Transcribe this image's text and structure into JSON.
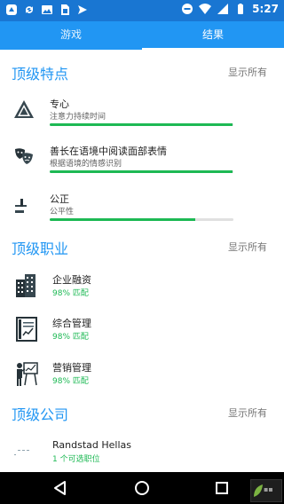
{
  "status_bar": {
    "time": "5:27",
    "left_icons": [
      "app-icon",
      "sync-icon",
      "image-icon",
      "sim-icon",
      "send-icon"
    ],
    "right_icons": [
      "do-not-disturb-icon",
      "wifi-icon",
      "signal-icon",
      "battery-icon"
    ]
  },
  "tabs": [
    {
      "label": "游戏",
      "active": false
    },
    {
      "label": "结果",
      "active": true
    }
  ],
  "sections": {
    "traits": {
      "title": "顶级特点",
      "show_all": "显示所有",
      "items": [
        {
          "title": "专心",
          "subtitle": "注意力持续时间",
          "level": 0.997,
          "icon": "warning-triangle-icon"
        },
        {
          "title": "善长在语境中阅读面部表情",
          "subtitle": "根据语境的情感识别",
          "level": 0.997,
          "icon": "theater-masks-icon"
        },
        {
          "title": "公正",
          "subtitle": "公平性",
          "level": 0.794,
          "icon": "gavel-icon"
        }
      ]
    },
    "careers": {
      "title": "顶级职业",
      "show_all": "显示所有",
      "items": [
        {
          "title": "企业融资",
          "match": "98% 匹配",
          "icon": "office-buildings-icon"
        },
        {
          "title": "综合管理",
          "match": "98% 匹配",
          "icon": "document-report-icon"
        },
        {
          "title": "营销管理",
          "match": "98% 匹配",
          "icon": "presentation-board-icon"
        }
      ]
    },
    "companies": {
      "title": "顶级公司",
      "show_all": "显示所有",
      "items": [
        {
          "name": "Randstad Hellas",
          "jobs": "1 个可选职位"
        }
      ]
    }
  },
  "navbar": {
    "buttons": [
      "back-icon",
      "home-icon",
      "recents-icon"
    ]
  },
  "colors": {
    "primary": "#2196f3",
    "status_bar": "#1976d2",
    "progress": "#1db954",
    "match_text": "#1db954"
  }
}
